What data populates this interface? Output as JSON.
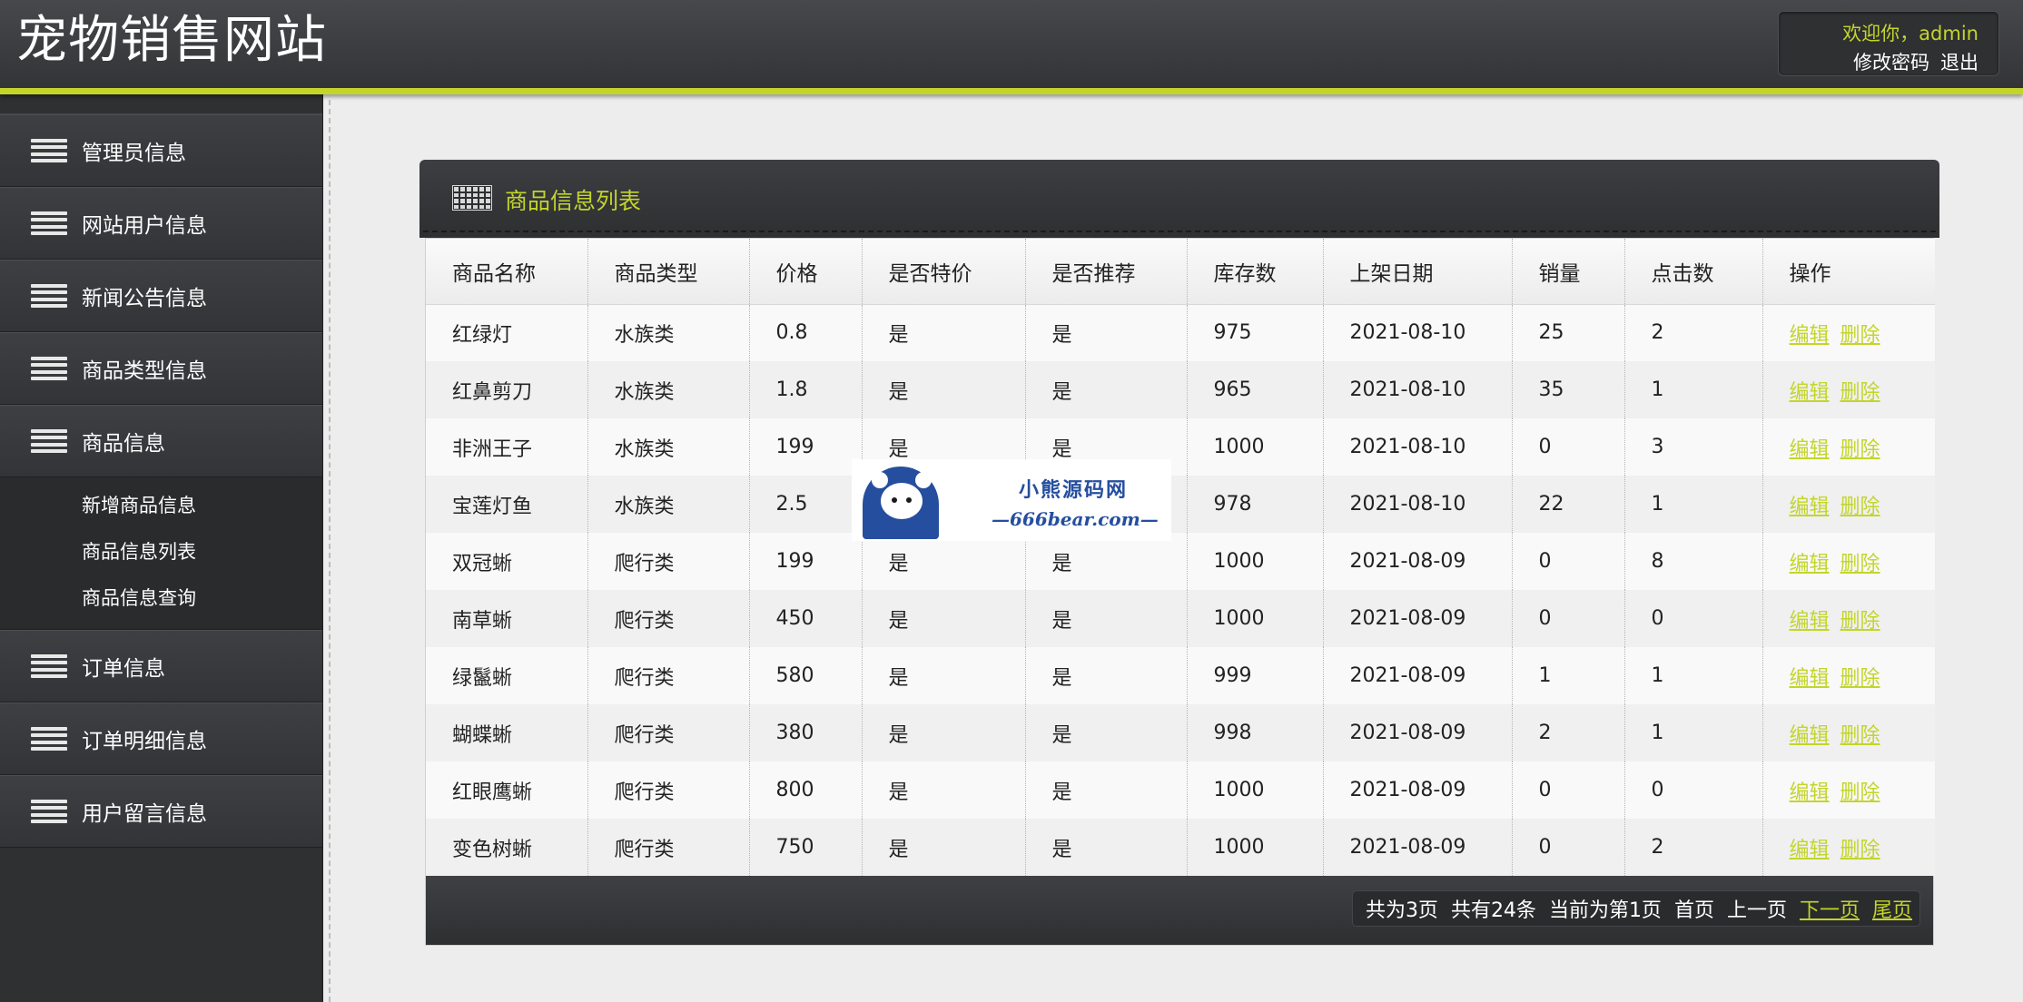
{
  "header": {
    "site_title": "宠物销售网站",
    "welcome": "欢迎你，admin",
    "change_password": "修改密码",
    "logout": "退出"
  },
  "sidebar": {
    "items": [
      {
        "label": "管理员信息",
        "icon": "menu-lines-icon"
      },
      {
        "label": "网站用户信息",
        "icon": "menu-lines-icon"
      },
      {
        "label": "新闻公告信息",
        "icon": "menu-lines-icon"
      },
      {
        "label": "商品类型信息",
        "icon": "menu-lines-icon"
      },
      {
        "label": "商品信息",
        "icon": "menu-lines-icon"
      },
      {
        "label": "订单信息",
        "icon": "menu-lines-icon"
      },
      {
        "label": "订单明细信息",
        "icon": "menu-lines-icon"
      },
      {
        "label": "用户留言信息",
        "icon": "menu-lines-icon"
      }
    ],
    "submenu": [
      "新增商品信息",
      "商品信息列表",
      "商品信息查询"
    ]
  },
  "panel": {
    "title": "商品信息列表",
    "icon": "grid-table-icon"
  },
  "table": {
    "columns": [
      "商品名称",
      "商品类型",
      "价格",
      "是否特价",
      "是否推荐",
      "库存数",
      "上架日期",
      "销量",
      "点击数",
      "操作"
    ],
    "rows": [
      [
        "红绿灯",
        "水族类",
        "0.8",
        "是",
        "是",
        "975",
        "2021-08-10",
        "25",
        "2"
      ],
      [
        "红鼻剪刀",
        "水族类",
        "1.8",
        "是",
        "是",
        "965",
        "2021-08-10",
        "35",
        "1"
      ],
      [
        "非洲王子",
        "水族类",
        "199",
        "是",
        "是",
        "1000",
        "2021-08-10",
        "0",
        "3"
      ],
      [
        "宝莲灯鱼",
        "水族类",
        "2.5",
        "",
        "",
        "978",
        "2021-08-10",
        "22",
        "1"
      ],
      [
        "双冠蜥",
        "爬行类",
        "199",
        "是",
        "是",
        "1000",
        "2021-08-09",
        "0",
        "8"
      ],
      [
        "南草蜥",
        "爬行类",
        "450",
        "是",
        "是",
        "1000",
        "2021-08-09",
        "0",
        "0"
      ],
      [
        "绿鬣蜥",
        "爬行类",
        "580",
        "是",
        "是",
        "999",
        "2021-08-09",
        "1",
        "1"
      ],
      [
        "蝴蝶蜥",
        "爬行类",
        "380",
        "是",
        "是",
        "998",
        "2021-08-09",
        "2",
        "1"
      ],
      [
        "红眼鹰蜥",
        "爬行类",
        "800",
        "是",
        "是",
        "1000",
        "2021-08-09",
        "0",
        "0"
      ],
      [
        "变色树蜥",
        "爬行类",
        "750",
        "是",
        "是",
        "1000",
        "2021-08-09",
        "0",
        "2"
      ]
    ],
    "edit_label": "编辑",
    "delete_label": "删除"
  },
  "pager": {
    "total_pages": "共为3页",
    "total_records": "共有24条",
    "current_page": "当前为第1页",
    "first": "首页",
    "prev": "上一页",
    "next": "下一页",
    "last": "尾页"
  },
  "watermark": {
    "line1": "小熊源码网",
    "line2": "—666bear.com—"
  },
  "colors": {
    "accent": "#c3d52b",
    "header_bg": "#3a3b3e",
    "sidebar_bg": "#2f3032",
    "watermark_blue": "#254e9f"
  }
}
